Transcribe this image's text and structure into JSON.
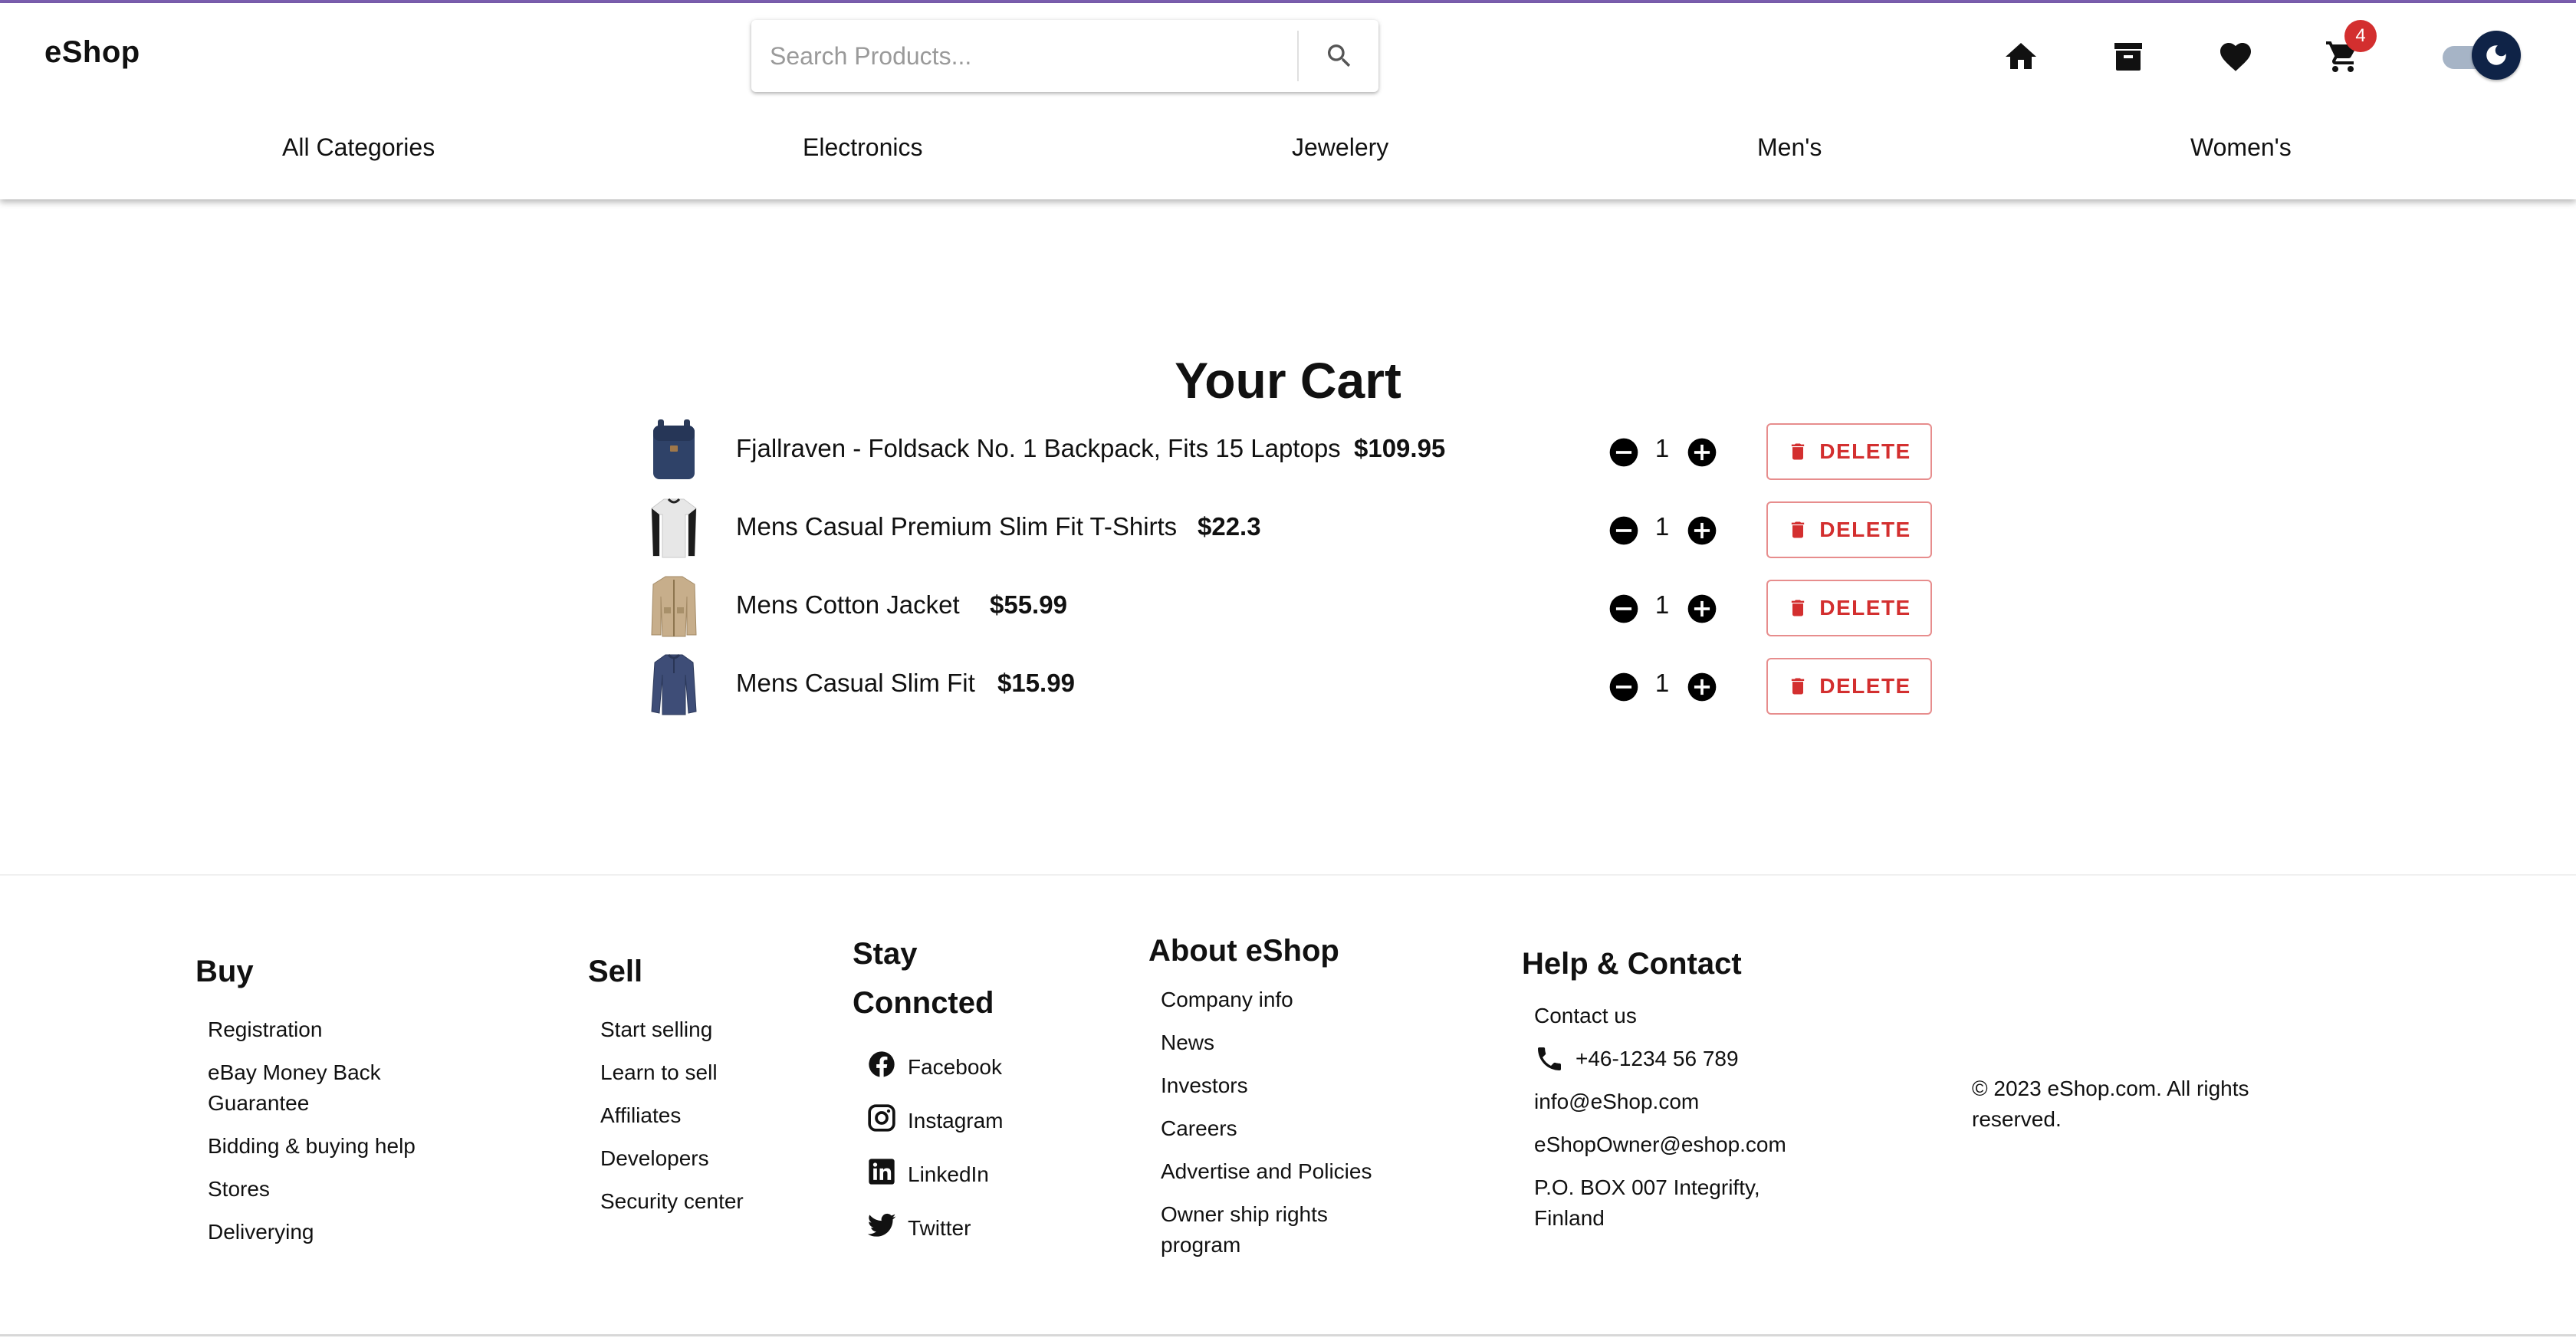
{
  "brand": "eShop",
  "search": {
    "placeholder": "Search Products..."
  },
  "cart_count": "4",
  "categories": [
    "All Categories",
    "Electronics",
    "Jewelery",
    "Men's",
    "Women's"
  ],
  "cart": {
    "title": "Your Cart",
    "delete_label": "DELETE",
    "items": [
      {
        "title": "Fjallraven - Foldsack No. 1 Backpack, Fits 15 Laptops",
        "price": "$109.95",
        "qty": "1"
      },
      {
        "title": "Mens Casual Premium Slim Fit T-Shirts",
        "price": "$22.3",
        "qty": "1"
      },
      {
        "title": "Mens Cotton Jacket",
        "price": "$55.99",
        "qty": "1"
      },
      {
        "title": "Mens Casual Slim Fit",
        "price": "$15.99",
        "qty": "1"
      }
    ]
  },
  "footer": {
    "buy": {
      "title": "Buy",
      "links": [
        "Registration",
        "eBay Money Back Guarantee",
        "Bidding & buying help",
        "Stores",
        "Deliverying"
      ]
    },
    "sell": {
      "title": "Sell",
      "links": [
        "Start selling",
        "Learn to sell",
        "Affiliates",
        "Developers",
        "Security center"
      ]
    },
    "stay": {
      "title": "Stay Conncted",
      "links": [
        "Facebook",
        "Instagram",
        "LinkedIn",
        "Twitter"
      ]
    },
    "about": {
      "title": "About eShop",
      "links": [
        "Company info",
        "News",
        "Investors",
        "Careers",
        "Advertise and Policies",
        "Owner ship rights program"
      ]
    },
    "help": {
      "title": "Help & Contact",
      "contact_us": "Contact us",
      "phone": "+46-1234 56 789",
      "email1": "info@eShop.com",
      "email2": "eShopOwner@eshop.com",
      "address": "P.O. BOX 007 Integrifty, Finland"
    },
    "copyright": "© 2023 eShop.com. All rights reserved."
  }
}
